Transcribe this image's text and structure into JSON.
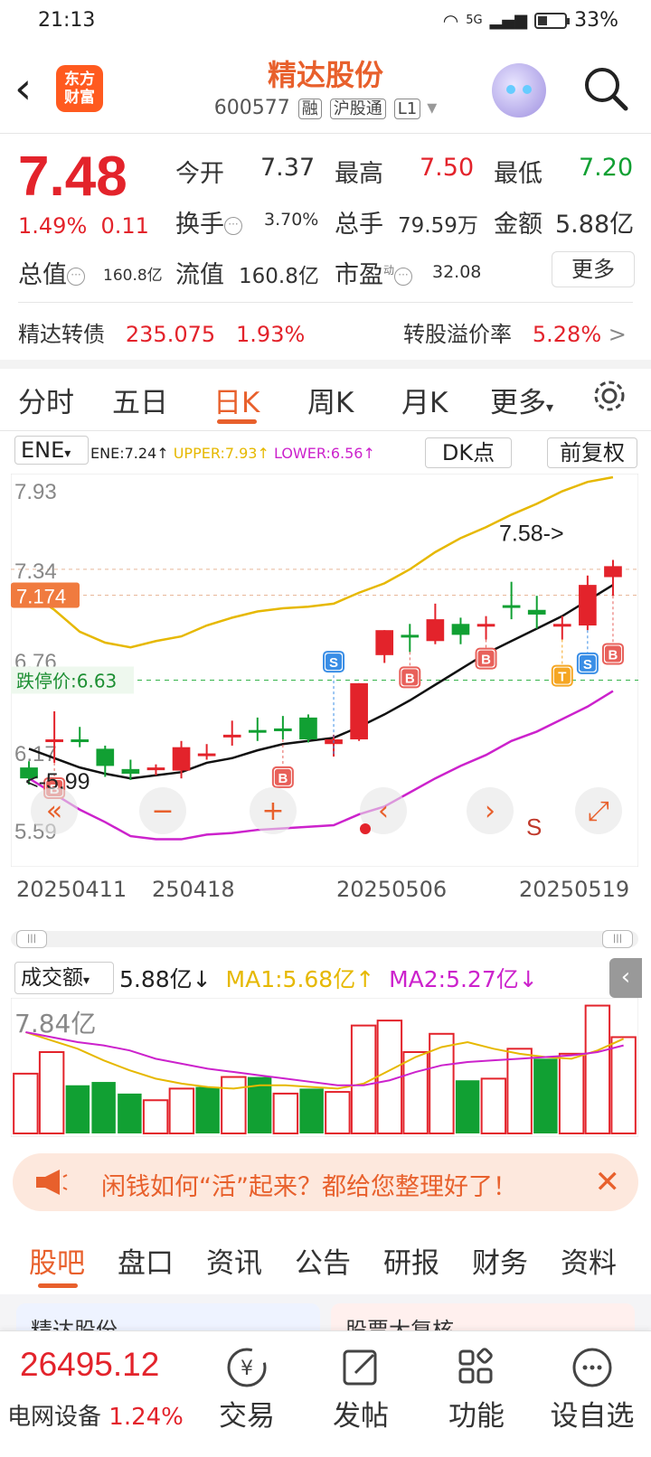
{
  "status": {
    "time": "21:13",
    "network": "5G",
    "battery": "33%"
  },
  "header": {
    "title": "精达股份",
    "code": "600577",
    "tags": [
      "融",
      "沪股通",
      "L1"
    ],
    "logo_line1": "东方",
    "logo_line2": "财富"
  },
  "quote": {
    "price": "7.48",
    "pct": "1.49%",
    "chg": "0.11",
    "open_label": "今开",
    "open": "7.37",
    "high_label": "最高",
    "high": "7.50",
    "low_label": "最低",
    "low": "7.20",
    "turnover_label": "换手",
    "turnover": "3.70%",
    "volume_label": "总手",
    "volume": "79.59万",
    "amount_label": "金额",
    "amount": "5.88亿",
    "mcap_label": "总值",
    "mcap": "160.8亿",
    "float_label": "流值",
    "float": "160.8亿",
    "pe_label": "市盈",
    "pe_sup": "动",
    "pe": "32.08",
    "more": "更多"
  },
  "bond": {
    "name": "精达转债",
    "price": "235.075",
    "pct": "1.93%",
    "premium_label": "转股溢价率",
    "premium": "5.28%",
    "arrow": ">"
  },
  "tabs": [
    "分时",
    "五日",
    "日K",
    "周K",
    "月K",
    "更多"
  ],
  "active_tab": "日K",
  "indicator": {
    "name": "ENE",
    "ene": "ENE:7.24",
    "upper": "UPPER:7.93",
    "lower": "LOWER:6.56",
    "up_arrow": "↑",
    "dk": "DK点",
    "adjust": "前复权"
  },
  "chart_labels": {
    "y_ticks": [
      "7.93",
      "7.34",
      "6.76",
      "6.17",
      "5.59"
    ],
    "current_price_tag": "7.174",
    "limit_down": "跌停价:6.63",
    "high_marker": "7.58->",
    "low_marker": "<-5.99",
    "dates": [
      "20250411",
      "250418",
      "20250506",
      "20250519"
    ]
  },
  "chart_data": {
    "type": "candlestick",
    "ylim": [
      5.59,
      7.93
    ],
    "candles": [
      {
        "o": 6.07,
        "c": 6.0,
        "h": 6.11,
        "l": 5.96,
        "dir": "down"
      },
      {
        "o": 6.25,
        "c": 6.24,
        "h": 6.43,
        "l": 6.1,
        "dir": "up"
      },
      {
        "o": 6.25,
        "c": 6.25,
        "h": 6.33,
        "l": 6.2,
        "dir": "down"
      },
      {
        "o": 6.08,
        "c": 6.19,
        "h": 6.21,
        "l": 6.01,
        "dir": "down"
      },
      {
        "o": 6.06,
        "c": 6.03,
        "h": 6.12,
        "l": 5.99,
        "dir": "down"
      },
      {
        "o": 6.06,
        "c": 6.07,
        "h": 6.09,
        "l": 6.02,
        "dir": "up"
      },
      {
        "o": 6.05,
        "c": 6.2,
        "h": 6.24,
        "l": 6.0,
        "dir": "up"
      },
      {
        "o": 6.16,
        "c": 6.15,
        "h": 6.22,
        "l": 6.12,
        "dir": "up"
      },
      {
        "o": 6.28,
        "c": 6.27,
        "h": 6.37,
        "l": 6.21,
        "dir": "up"
      },
      {
        "o": 6.31,
        "c": 6.31,
        "h": 6.39,
        "l": 6.24,
        "dir": "down"
      },
      {
        "o": 6.32,
        "c": 6.32,
        "h": 6.4,
        "l": 6.25,
        "dir": "down"
      },
      {
        "o": 6.39,
        "c": 6.25,
        "h": 6.41,
        "l": 6.23,
        "dir": "down"
      },
      {
        "o": 6.22,
        "c": 6.25,
        "h": 6.28,
        "l": 6.14,
        "dir": "up"
      },
      {
        "o": 6.25,
        "c": 6.61,
        "h": 6.61,
        "l": 6.24,
        "dir": "up"
      },
      {
        "o": 6.79,
        "c": 6.95,
        "h": 6.95,
        "l": 6.74,
        "dir": "up"
      },
      {
        "o": 6.92,
        "c": 6.92,
        "h": 6.99,
        "l": 6.81,
        "dir": "down"
      },
      {
        "o": 6.88,
        "c": 7.02,
        "h": 7.12,
        "l": 6.86,
        "dir": "up"
      },
      {
        "o": 6.99,
        "c": 6.92,
        "h": 7.03,
        "l": 6.86,
        "dir": "down"
      },
      {
        "o": 6.99,
        "c": 6.99,
        "h": 7.04,
        "l": 6.89,
        "dir": "up"
      },
      {
        "o": 7.11,
        "c": 7.1,
        "h": 7.26,
        "l": 7.02,
        "dir": "down"
      },
      {
        "o": 7.05,
        "c": 7.08,
        "h": 7.17,
        "l": 6.96,
        "dir": "down"
      },
      {
        "o": 6.99,
        "c": 6.98,
        "h": 7.04,
        "l": 6.89,
        "dir": "up"
      },
      {
        "o": 6.98,
        "c": 7.24,
        "h": 7.3,
        "l": 6.95,
        "dir": "up"
      },
      {
        "o": 7.29,
        "c": 7.36,
        "h": 7.4,
        "l": 7.17,
        "dir": "up"
      }
    ],
    "ene_line": [
      6.19,
      6.13,
      6.07,
      6.03,
      6.0,
      6.02,
      6.04,
      6.1,
      6.13,
      6.18,
      6.22,
      6.24,
      6.26,
      6.33,
      6.41,
      6.5,
      6.6,
      6.7,
      6.8,
      6.88,
      6.96,
      7.04,
      7.14,
      7.24
    ],
    "upper_line": [
      7.19,
      7.08,
      6.94,
      6.87,
      6.84,
      6.88,
      6.91,
      6.98,
      7.03,
      7.07,
      7.09,
      7.1,
      7.12,
      7.19,
      7.25,
      7.34,
      7.45,
      7.54,
      7.61,
      7.69,
      7.76,
      7.84,
      7.9,
      7.93
    ],
    "lower_line": [
      6.0,
      5.9,
      5.8,
      5.72,
      5.63,
      5.61,
      5.61,
      5.64,
      5.65,
      5.67,
      5.68,
      5.69,
      5.7,
      5.77,
      5.82,
      5.91,
      6.0,
      6.08,
      6.15,
      6.24,
      6.3,
      6.38,
      6.46,
      6.56
    ],
    "limit_down": 6.63,
    "markers": [
      {
        "i": 1,
        "label": "B",
        "at": 5.99
      },
      {
        "i": 10,
        "label": "B",
        "at": 6.06
      },
      {
        "i": 12,
        "label": "S",
        "at": 6.8
      },
      {
        "i": 15,
        "label": "B",
        "at": 6.7
      },
      {
        "i": 18,
        "label": "B",
        "at": 6.82
      },
      {
        "i": 21,
        "label": "T",
        "at": 6.71
      },
      {
        "i": 22,
        "label": "S",
        "at": 6.79
      },
      {
        "i": 23,
        "label": "B",
        "at": 6.85
      }
    ]
  },
  "volume": {
    "label": "成交额",
    "value": "5.88亿",
    "down_arrow": "↓",
    "up_arrow": "↑",
    "ma1": "MA1:5.68亿",
    "ma2": "MA2:5.27亿",
    "ymax_label": "7.84亿",
    "ymax": 7.84,
    "bars": [
      {
        "v": 3.6,
        "dir": "up"
      },
      {
        "v": 4.9,
        "dir": "up"
      },
      {
        "v": 2.9,
        "dir": "down"
      },
      {
        "v": 3.1,
        "dir": "down"
      },
      {
        "v": 2.4,
        "dir": "down"
      },
      {
        "v": 2.0,
        "dir": "up"
      },
      {
        "v": 2.7,
        "dir": "up"
      },
      {
        "v": 2.8,
        "dir": "down"
      },
      {
        "v": 3.4,
        "dir": "up"
      },
      {
        "v": 3.4,
        "dir": "down"
      },
      {
        "v": 2.4,
        "dir": "up"
      },
      {
        "v": 2.7,
        "dir": "down"
      },
      {
        "v": 2.5,
        "dir": "up"
      },
      {
        "v": 6.5,
        "dir": "up"
      },
      {
        "v": 6.8,
        "dir": "up"
      },
      {
        "v": 4.9,
        "dir": "up"
      },
      {
        "v": 6.0,
        "dir": "up"
      },
      {
        "v": 3.2,
        "dir": "down"
      },
      {
        "v": 3.3,
        "dir": "up"
      },
      {
        "v": 5.1,
        "dir": "up"
      },
      {
        "v": 4.5,
        "dir": "down"
      },
      {
        "v": 4.8,
        "dir": "up"
      },
      {
        "v": 7.7,
        "dir": "up"
      },
      {
        "v": 5.8,
        "dir": "up"
      }
    ],
    "ma1_line": [
      6.1,
      5.6,
      5.1,
      4.4,
      3.8,
      3.3,
      3.0,
      2.8,
      2.7,
      2.9,
      2.9,
      2.8,
      2.7,
      3.0,
      3.8,
      4.6,
      5.2,
      5.5,
      5.1,
      4.8,
      4.6,
      4.5,
      5.0,
      5.7
    ],
    "ma2_line": [
      6.1,
      5.8,
      5.5,
      5.3,
      5.0,
      4.5,
      4.2,
      3.9,
      3.7,
      3.5,
      3.3,
      3.1,
      2.9,
      2.9,
      3.2,
      3.7,
      4.1,
      4.3,
      4.4,
      4.5,
      4.6,
      4.7,
      4.9,
      5.3
    ]
  },
  "banner": {
    "text": "闲钱如何“活”起来？都给您整理好了！"
  },
  "bottom_tabs": [
    "股吧",
    "盘口",
    "资讯",
    "公告",
    "研报",
    "财务",
    "资料"
  ],
  "active_bottom_tab": "股吧",
  "cards": {
    "left_text": "精达股份",
    "right_text": "股票大复核"
  },
  "footer": {
    "index_value": "26495.12",
    "index_name": "电网设备",
    "index_pct": "1.24%",
    "nav": [
      "交易",
      "发帖",
      "功能",
      "设自选"
    ]
  },
  "colors": {
    "up": "#e3232b",
    "down": "#11a033",
    "accent": "#e8602c",
    "upper": "#e6b800",
    "lower": "#cc22cc"
  }
}
